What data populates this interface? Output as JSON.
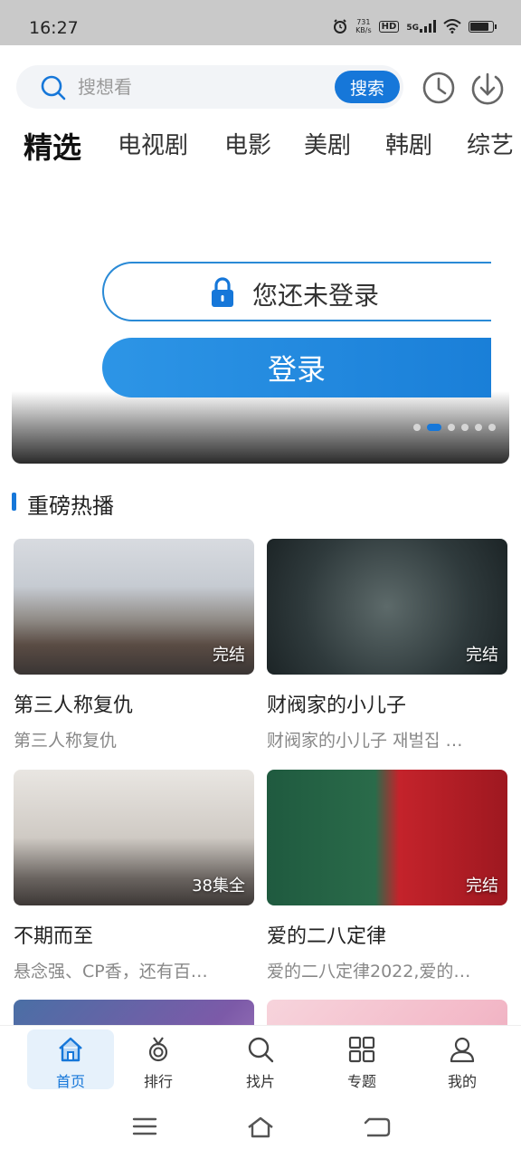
{
  "status_bar": {
    "time": "16:27",
    "net_speed_value": "731",
    "net_speed_unit": "KB/s",
    "hd": "HD",
    "signal": "5G",
    "battery_level": 0.85
  },
  "search": {
    "placeholder": "搜想看",
    "button_label": "搜索"
  },
  "tabs": [
    {
      "label": "精选",
      "active": true
    },
    {
      "label": "电视剧"
    },
    {
      "label": "电影"
    },
    {
      "label": "美剧"
    },
    {
      "label": "韩剧"
    },
    {
      "label": "综艺"
    }
  ],
  "banner": {
    "login_tip": "您还未登录",
    "login_button": "登录",
    "pages": 6,
    "current_page": 2
  },
  "section": {
    "title": "重磅热播"
  },
  "cards": [
    {
      "title": "第三人称复仇",
      "subtitle": "第三人称复仇",
      "badge": "完结"
    },
    {
      "title": "财阀家的小儿子",
      "subtitle": "财阀家的小儿子 재벌집 …",
      "badge": "完结"
    },
    {
      "title": "不期而至",
      "subtitle": "悬念强、CP香，还有百…",
      "badge": "38集全"
    },
    {
      "title": "爱的二八定律",
      "subtitle": "爱的二八定律2022,爱的…",
      "badge": "完结"
    }
  ],
  "bottom_nav": [
    {
      "label": "首页",
      "icon": "home-icon",
      "active": true
    },
    {
      "label": "排行",
      "icon": "medal-icon"
    },
    {
      "label": "找片",
      "icon": "search-icon"
    },
    {
      "label": "专题",
      "icon": "grid-icon"
    },
    {
      "label": "我的",
      "icon": "person-icon"
    }
  ],
  "colors": {
    "accent": "#1677d9",
    "status_bar_bg": "#c9c9c9"
  }
}
